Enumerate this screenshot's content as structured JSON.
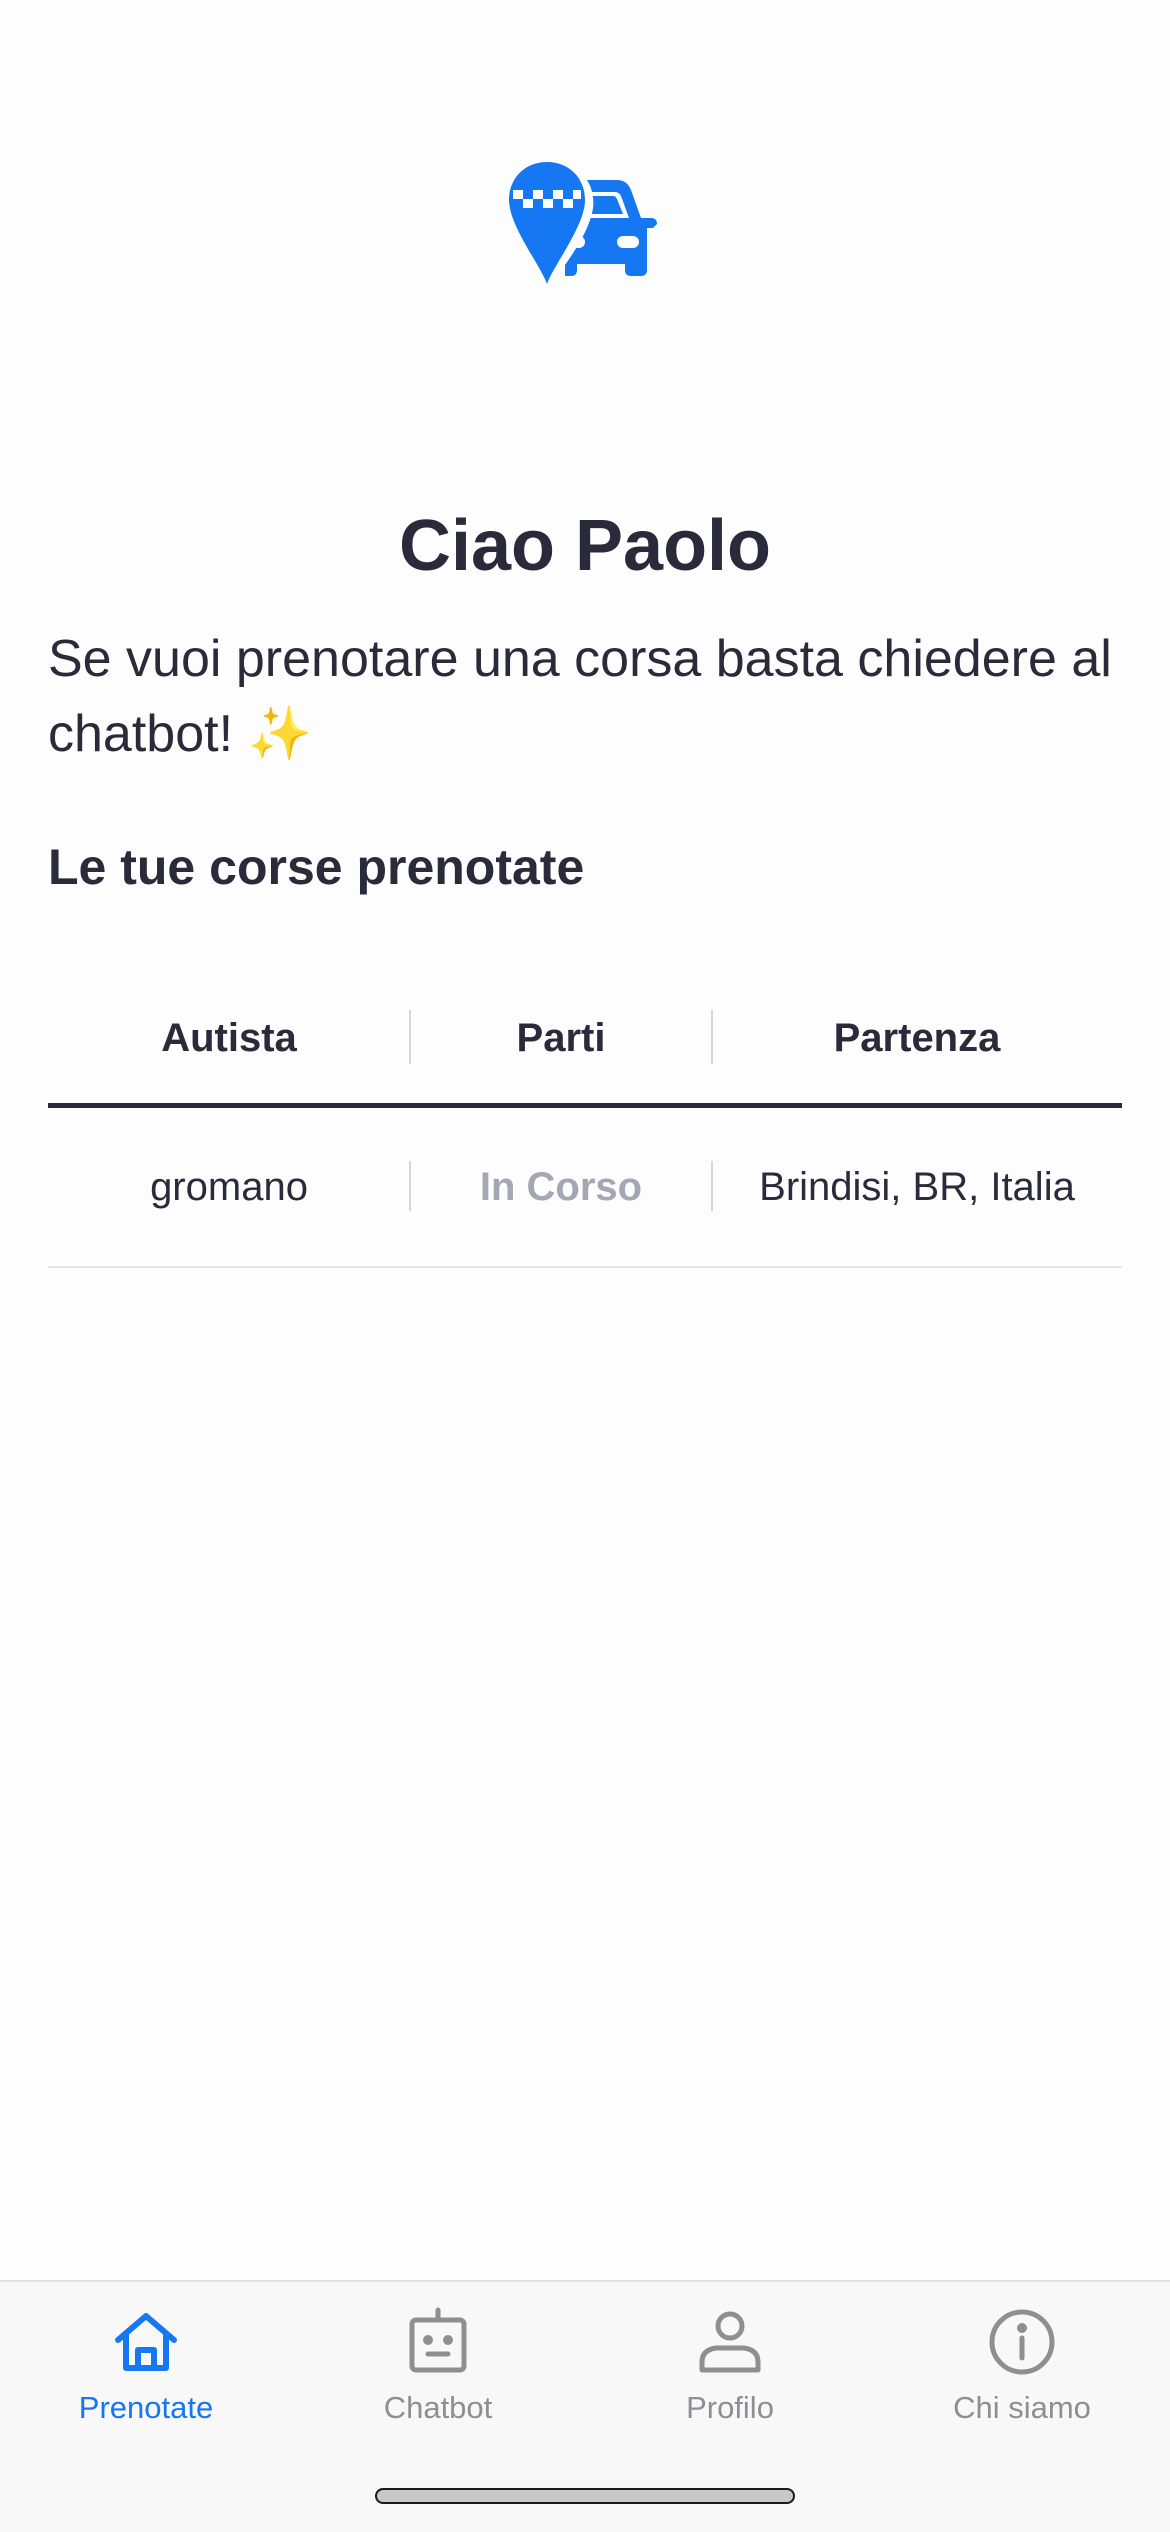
{
  "header": {
    "greeting": "Ciao Paolo",
    "intro": "Se vuoi prenotare una corsa basta chiedere al chatbot! ✨",
    "section_title": "Le tue corse prenotate"
  },
  "table": {
    "columns": [
      "Autista",
      "Parti",
      "Partenza"
    ],
    "rows": [
      {
        "driver": "gromano",
        "status": "In Corso",
        "departure": "Brindisi, BR, Italia"
      }
    ]
  },
  "tabbar": {
    "tabs": [
      {
        "label": "Prenotate",
        "icon": "home-icon",
        "active": true
      },
      {
        "label": "Chatbot",
        "icon": "robot-icon",
        "active": false
      },
      {
        "label": "Profilo",
        "icon": "person-icon",
        "active": false
      },
      {
        "label": "Chi siamo",
        "icon": "info-icon",
        "active": false
      }
    ]
  },
  "colors": {
    "accent": "#1677f3",
    "text": "#2b2a3a",
    "muted": "#a3a6b3",
    "inactive_tab": "#8e8e93"
  }
}
